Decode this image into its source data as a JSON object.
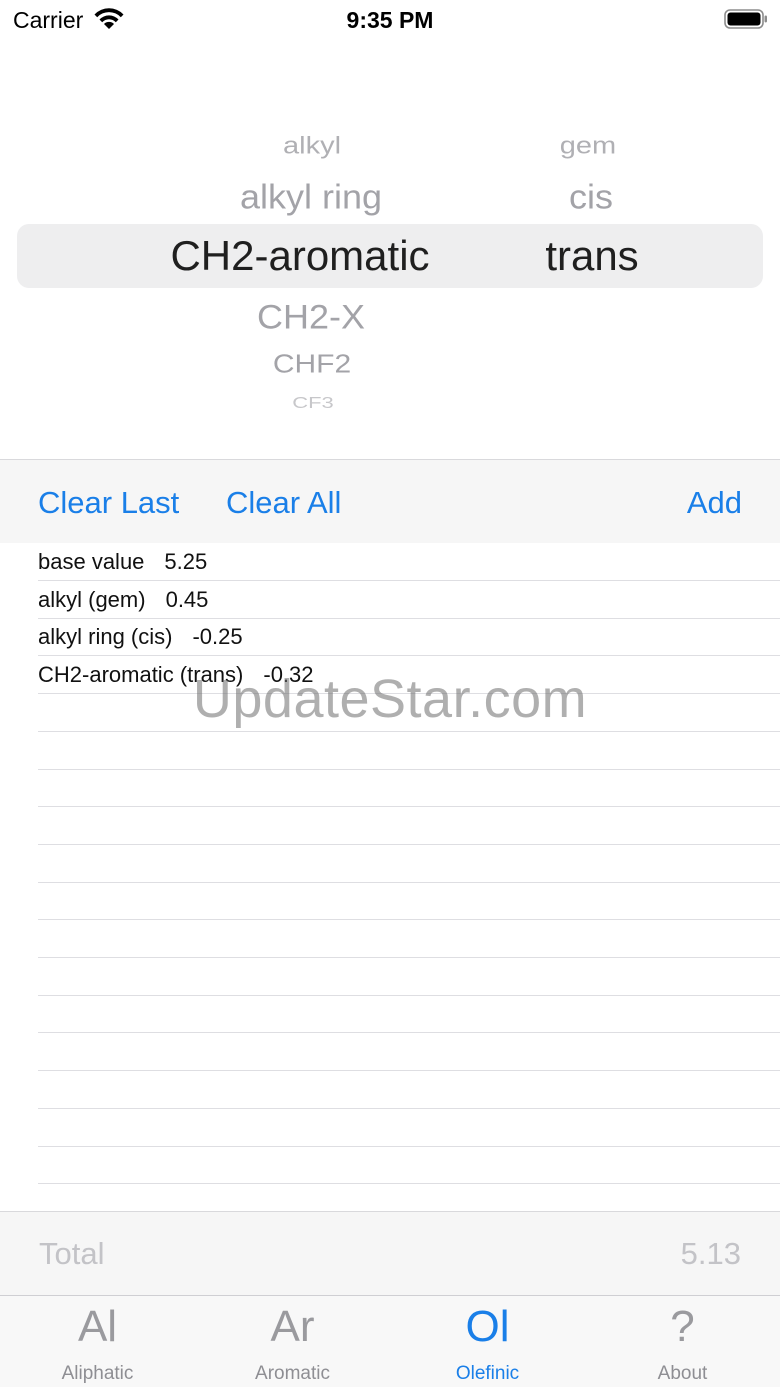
{
  "status_bar": {
    "carrier": "Carrier",
    "time": "9:35 PM"
  },
  "picker": {
    "left_column": [
      "alkyl",
      "alkyl ring",
      "CH2-aromatic",
      "CH2-X",
      "CHF2",
      "CF3"
    ],
    "left_selected": "CH2-aromatic",
    "right_column": [
      "gem",
      "cis",
      "trans"
    ],
    "right_selected": "trans"
  },
  "toolbar": {
    "clear_last": "Clear Last",
    "clear_all": "Clear All",
    "add": "Add"
  },
  "entries": [
    {
      "label": "base value",
      "value": "5.25"
    },
    {
      "label": "alkyl (gem)",
      "value": "0.45"
    },
    {
      "label": "alkyl ring (cis)",
      "value": "-0.25"
    },
    {
      "label": "CH2-aromatic (trans)",
      "value": "-0.32"
    }
  ],
  "watermark": "UpdateStar.com",
  "total": {
    "label": "Total",
    "value": "5.13"
  },
  "tabs": [
    {
      "icon": "Al",
      "label": "Aliphatic",
      "active": false
    },
    {
      "icon": "Ar",
      "label": "Aromatic",
      "active": false
    },
    {
      "icon": "Ol",
      "label": "Olefinic",
      "active": true
    },
    {
      "icon": "?",
      "label": "About",
      "active": false
    }
  ],
  "colors": {
    "accent": "#1a7fe8",
    "inactive": "#8e8e93",
    "disabled_text": "#c3c3c7"
  }
}
